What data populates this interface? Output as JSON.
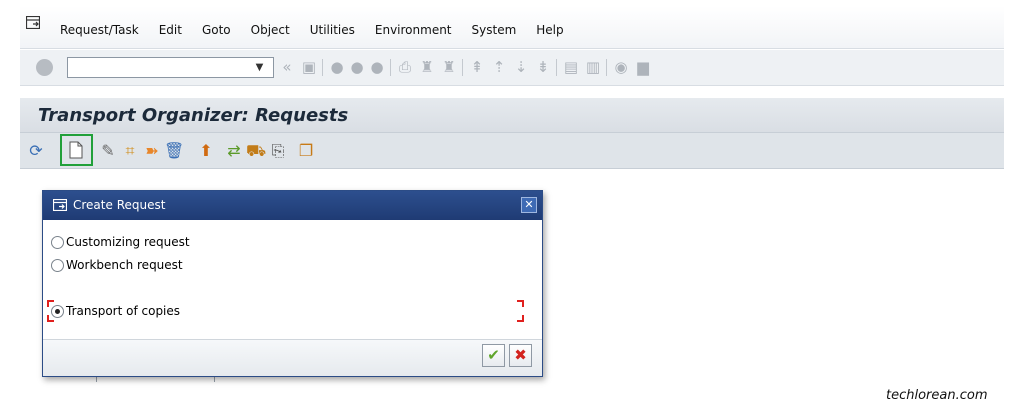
{
  "menubar": {
    "items": [
      "Request/Task",
      "Edit",
      "Goto",
      "Object",
      "Utilities",
      "Environment",
      "System",
      "Help"
    ]
  },
  "toolbar": {
    "command_field_value": "",
    "icons": [
      "enter-icon",
      "back-icon",
      "save-icon",
      "back-arrow-icon",
      "exit-icon",
      "cancel-icon",
      "print-icon",
      "find-icon",
      "find-next-icon",
      "first-page-icon",
      "previous-page-icon",
      "next-page-icon",
      "last-page-icon",
      "new-session-icon",
      "shortcut-icon",
      "help-icon",
      "layout-icon"
    ]
  },
  "title": "Transport Organizer: Requests",
  "app_toolbar": {
    "icons": [
      "refresh-icon",
      "create-icon",
      "display-change-icon",
      "hierarchy-icon",
      "release-icon",
      "delete-icon",
      "merge-icon",
      "transport-icon",
      "truck-icon",
      "documentation-icon",
      "copy-icon"
    ],
    "highlight_color": "#21a03a"
  },
  "dialog": {
    "title": "Create Request",
    "options": [
      {
        "label": "Customizing request",
        "selected": false
      },
      {
        "label": "Workbench request",
        "selected": false
      },
      {
        "label": "Transport of copies",
        "selected": true
      }
    ],
    "confirm_icon": "checkmark-icon",
    "cancel_icon": "cross-icon",
    "header_color": "#1f3b74"
  },
  "watermark": "techlorean.com"
}
